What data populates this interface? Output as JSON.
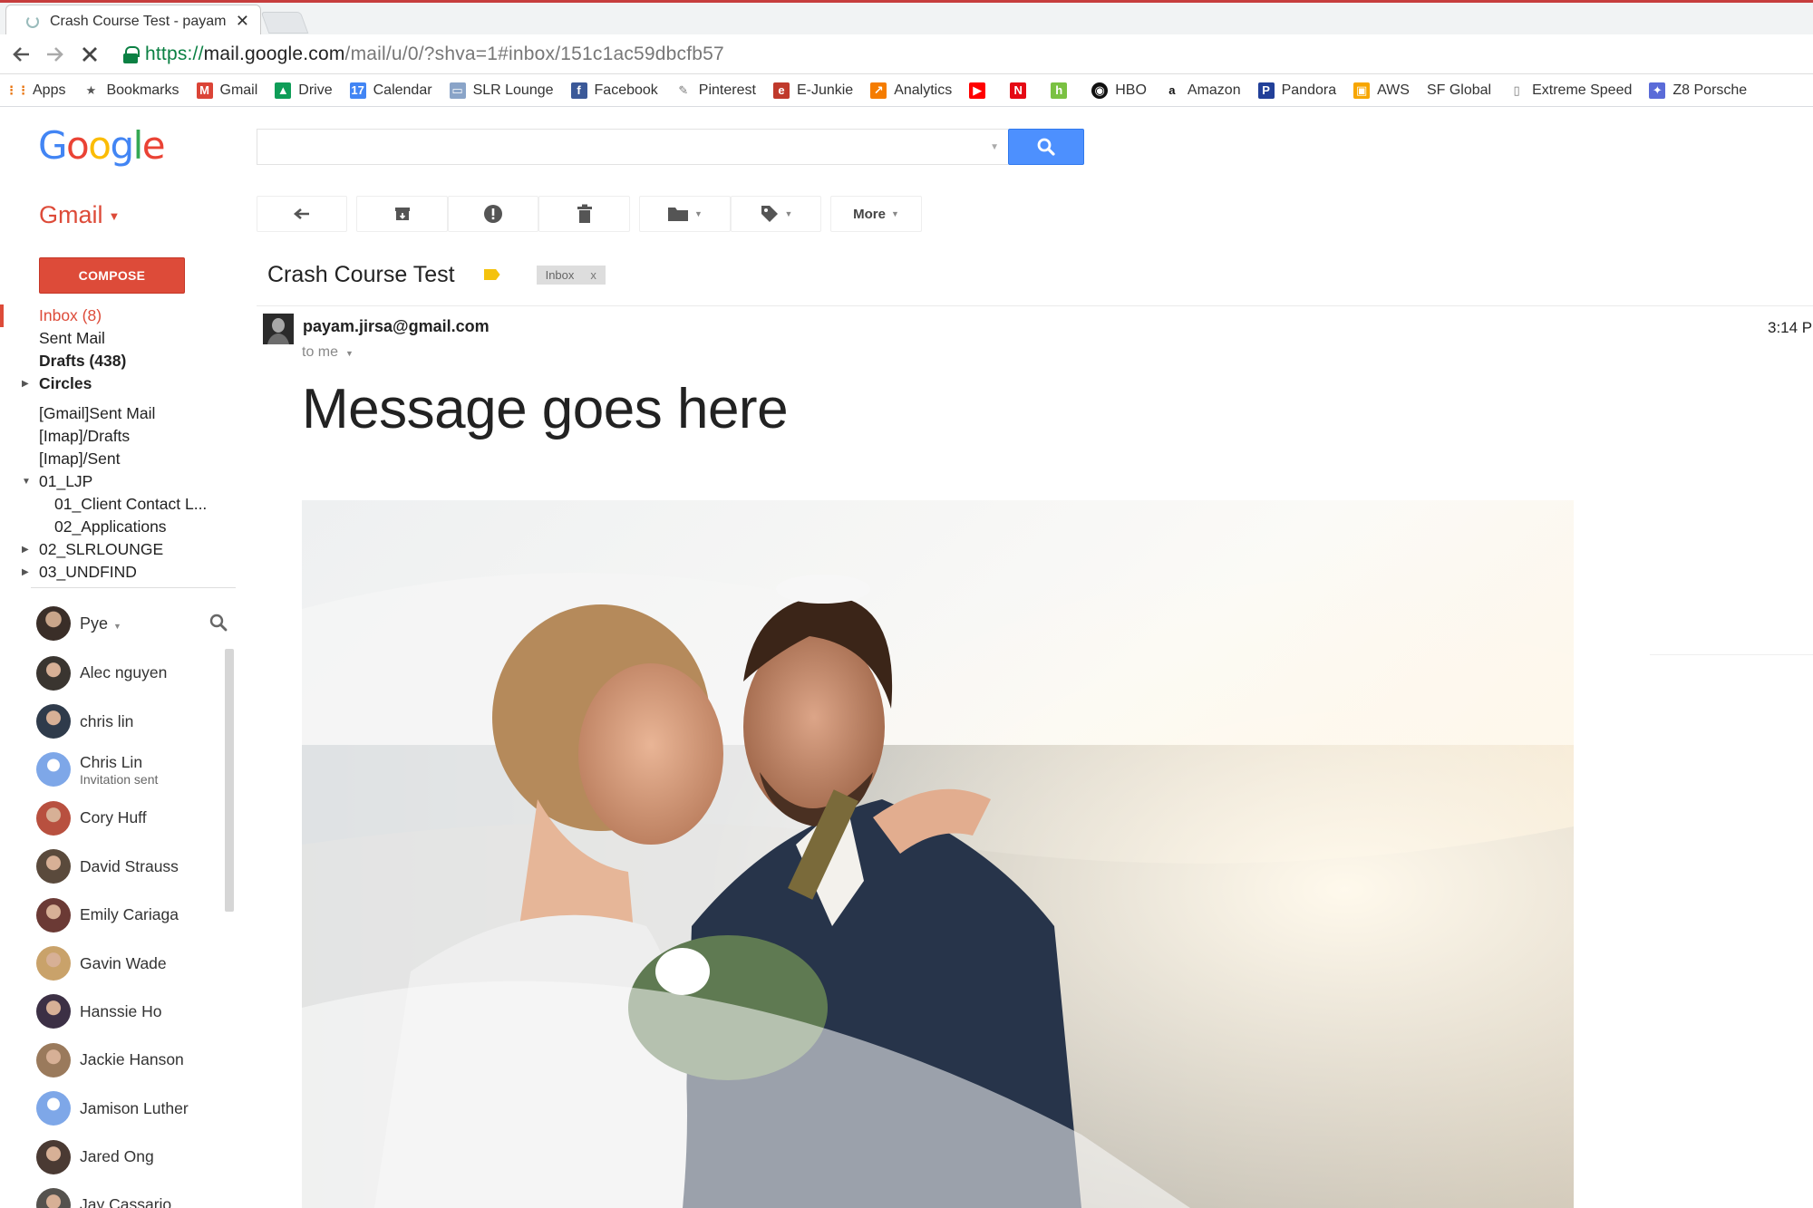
{
  "browser": {
    "tab_title": "Crash Course Test - payam",
    "tab_close": "✕",
    "url_scheme": "https://",
    "url_host": "mail.google.com",
    "url_path": "/mail/u/0/?shva=1#inbox/151c1ac59dbcfb57",
    "bookmarks": [
      {
        "label": "Apps",
        "icon": "apps-grid-icon",
        "color": "#e8710a"
      },
      {
        "label": "Bookmarks",
        "icon": "star-icon",
        "color": "#555555"
      },
      {
        "label": "Gmail",
        "icon": "gmail-icon",
        "color": "#db4437"
      },
      {
        "label": "Drive",
        "icon": "drive-icon",
        "color": "#0f9d58"
      },
      {
        "label": "Calendar",
        "icon": "calendar-icon",
        "color": "#4285f4"
      },
      {
        "label": "SLR Lounge",
        "icon": "slr-lounge-icon",
        "color": "#8aa4c8"
      },
      {
        "label": "Facebook",
        "icon": "facebook-icon",
        "color": "#3b5998"
      },
      {
        "label": "Pinterest",
        "icon": "pinterest-icon",
        "color": "#777777"
      },
      {
        "label": "E-Junkie",
        "icon": "e-junkie-icon",
        "color": "#c0392b"
      },
      {
        "label": "Analytics",
        "icon": "analytics-icon",
        "color": "#f57c00"
      },
      {
        "label": "",
        "icon": "youtube-icon",
        "color": "#ff0000"
      },
      {
        "label": "",
        "icon": "netflix-icon",
        "color": "#e50914"
      },
      {
        "label": "",
        "icon": "houzz-icon",
        "color": "#7ac142"
      },
      {
        "label": "HBO",
        "icon": "hbo-icon",
        "color": "#111111"
      },
      {
        "label": "Amazon",
        "icon": "amazon-icon",
        "color": "#111111"
      },
      {
        "label": "Pandora",
        "icon": "pandora-icon",
        "color": "#224099"
      },
      {
        "label": "AWS",
        "icon": "aws-icon",
        "color": "#f7a600"
      },
      {
        "label": "SF Global",
        "icon": "",
        "color": ""
      },
      {
        "label": "Extreme Speed",
        "icon": "page-icon",
        "color": "#777777"
      },
      {
        "label": "Z8 Porsche",
        "icon": "porsche-icon",
        "color": "#5a6bd8"
      }
    ]
  },
  "gmail": {
    "logo_letters": [
      "G",
      "o",
      "o",
      "g",
      "l",
      "e"
    ],
    "app_label": "Gmail",
    "toolbar_more": "More",
    "compose": "COMPOSE",
    "colors": {
      "accent": "#dd4b39",
      "search": "#4d90fe",
      "important": "#f4c20d"
    }
  },
  "nav": {
    "inbox": "Inbox (8)",
    "sent": "Sent Mail",
    "drafts": "Drafts (438)",
    "circles": "Circles",
    "gmail_sent": "[Gmail]Sent Mail",
    "imap_drafts": "[Imap]/Drafts",
    "imap_sent": "[Imap]/Sent",
    "ljp": "01_LJP",
    "client_contact": "01_Client Contact L...",
    "applications": "02_Applications",
    "slrlounge": "02_SLRLOUNGE",
    "undfind": "03_UNDFIND"
  },
  "hangouts": {
    "me": "Pye",
    "contacts": [
      {
        "name": "Alec nguyen",
        "status": ""
      },
      {
        "name": "chris lin",
        "status": ""
      },
      {
        "name": "Chris Lin",
        "status": "Invitation sent"
      },
      {
        "name": "Cory Huff",
        "status": ""
      },
      {
        "name": "David Strauss",
        "status": ""
      },
      {
        "name": "Emily Cariaga",
        "status": ""
      },
      {
        "name": "Gavin Wade",
        "status": ""
      },
      {
        "name": "Hanssie Ho",
        "status": ""
      },
      {
        "name": "Jackie Hanson",
        "status": ""
      },
      {
        "name": "Jamison Luther",
        "status": ""
      },
      {
        "name": "Jared Ong",
        "status": ""
      },
      {
        "name": "Jay Cassario",
        "status": ""
      }
    ]
  },
  "message": {
    "subject": "Crash Course Test",
    "label": "Inbox",
    "label_remove": "x",
    "from": "payam.jirsa@gmail.com",
    "to": "to me",
    "time": "3:14 P",
    "body": "Message goes here"
  }
}
